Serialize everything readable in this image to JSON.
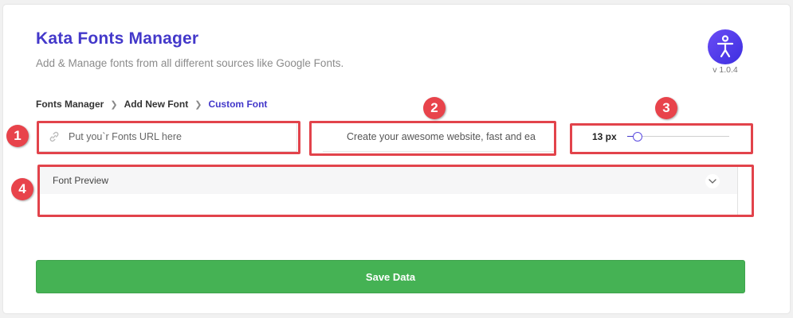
{
  "header": {
    "title": "Kata Fonts Manager",
    "subtitle": "Add & Manage fonts from all different sources like Google Fonts.",
    "version": "v 1.0.4",
    "logo_icon": "accessibility-figure-icon"
  },
  "breadcrumb": {
    "items": [
      "Fonts Manager",
      "Add New Font",
      "Custom Font"
    ]
  },
  "form": {
    "url_placeholder": "Put you`r Fonts URL here",
    "url_value": "",
    "preview_text": "Create your awesome website, fast and ea",
    "size_value": "13 px",
    "size_slider_fraction": 0.1
  },
  "preview": {
    "label": "Font Preview"
  },
  "actions": {
    "save_label": "Save Data"
  },
  "annotations": [
    "1",
    "2",
    "3",
    "4"
  ],
  "colors": {
    "brand": "#4338ca",
    "save": "#45b254",
    "annotation": "#e2434b"
  }
}
